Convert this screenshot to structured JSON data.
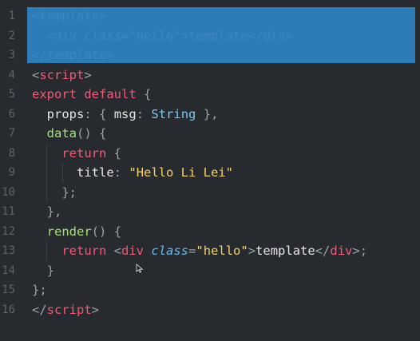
{
  "editor": {
    "line_numbers": [
      "1",
      "2",
      "3",
      "4",
      "5",
      "6",
      "7",
      "8",
      "9",
      "10",
      "11",
      "12",
      "13",
      "14",
      "15",
      "16"
    ],
    "lines": [
      {
        "indent": "",
        "tokens": [
          {
            "c": "t-punc",
            "t": "<"
          },
          {
            "c": "t-tag",
            "t": "template"
          },
          {
            "c": "t-punc",
            "t": ">"
          }
        ]
      },
      {
        "indent": "  ",
        "tokens": [
          {
            "c": "t-punc",
            "t": "<"
          },
          {
            "c": "t-tag",
            "t": "div"
          },
          {
            "c": "t-text",
            "t": " "
          },
          {
            "c": "t-attr",
            "t": "class"
          },
          {
            "c": "t-punc",
            "t": "="
          },
          {
            "c": "t-str",
            "t": "\"hello\""
          },
          {
            "c": "t-punc",
            "t": ">"
          },
          {
            "c": "t-text",
            "t": "template"
          },
          {
            "c": "t-punc",
            "t": "</"
          },
          {
            "c": "t-tag",
            "t": "div"
          },
          {
            "c": "t-punc",
            "t": ">"
          }
        ]
      },
      {
        "indent": "",
        "tokens": [
          {
            "c": "t-punc",
            "t": "</"
          },
          {
            "c": "t-tag",
            "t": "template"
          },
          {
            "c": "t-punc",
            "t": ">"
          }
        ]
      },
      {
        "indent": "",
        "tokens": [
          {
            "c": "t-punc",
            "t": "<"
          },
          {
            "c": "t-tag",
            "t": "script"
          },
          {
            "c": "t-punc",
            "t": ">"
          }
        ]
      },
      {
        "indent": "",
        "tokens": [
          {
            "c": "t-kw",
            "t": "export"
          },
          {
            "c": "t-text",
            "t": " "
          },
          {
            "c": "t-kw",
            "t": "default"
          },
          {
            "c": "t-text",
            "t": " "
          },
          {
            "c": "t-punc",
            "t": "{"
          }
        ]
      },
      {
        "indent": "  ",
        "tokens": [
          {
            "c": "t-text",
            "t": "props"
          },
          {
            "c": "t-punc",
            "t": ":"
          },
          {
            "c": "t-text",
            "t": " "
          },
          {
            "c": "t-punc",
            "t": "{"
          },
          {
            "c": "t-text",
            "t": " msg"
          },
          {
            "c": "t-punc",
            "t": ":"
          },
          {
            "c": "t-text",
            "t": " "
          },
          {
            "c": "t-type",
            "t": "String"
          },
          {
            "c": "t-text",
            "t": " "
          },
          {
            "c": "t-punc",
            "t": "},"
          }
        ]
      },
      {
        "indent": "  ",
        "tokens": [
          {
            "c": "t-fn",
            "t": "data"
          },
          {
            "c": "t-punc",
            "t": "()"
          },
          {
            "c": "t-text",
            "t": " "
          },
          {
            "c": "t-punc",
            "t": "{"
          }
        ]
      },
      {
        "indent": "    ",
        "tokens": [
          {
            "c": "t-kw",
            "t": "return"
          },
          {
            "c": "t-text",
            "t": " "
          },
          {
            "c": "t-punc",
            "t": "{"
          }
        ]
      },
      {
        "indent": "      ",
        "tokens": [
          {
            "c": "t-text",
            "t": "title"
          },
          {
            "c": "t-punc",
            "t": ":"
          },
          {
            "c": "t-text",
            "t": " "
          },
          {
            "c": "t-str",
            "t": "\"Hello Li Lei\""
          }
        ]
      },
      {
        "indent": "    ",
        "tokens": [
          {
            "c": "t-punc",
            "t": "};"
          }
        ]
      },
      {
        "indent": "  ",
        "tokens": [
          {
            "c": "t-punc",
            "t": "},"
          }
        ]
      },
      {
        "indent": "  ",
        "tokens": [
          {
            "c": "t-fn",
            "t": "render"
          },
          {
            "c": "t-punc",
            "t": "()"
          },
          {
            "c": "t-text",
            "t": " "
          },
          {
            "c": "t-punc",
            "t": "{"
          }
        ]
      },
      {
        "indent": "    ",
        "tokens": [
          {
            "c": "t-kw",
            "t": "return"
          },
          {
            "c": "t-text",
            "t": " "
          },
          {
            "c": "t-punc",
            "t": "<"
          },
          {
            "c": "t-tag",
            "t": "div"
          },
          {
            "c": "t-text",
            "t": " "
          },
          {
            "c": "t-attr",
            "t": "class"
          },
          {
            "c": "t-punc",
            "t": "="
          },
          {
            "c": "t-str",
            "t": "\"hello\""
          },
          {
            "c": "t-punc",
            "t": ">"
          },
          {
            "c": "t-text",
            "t": "template"
          },
          {
            "c": "t-punc",
            "t": "</"
          },
          {
            "c": "t-tag",
            "t": "div"
          },
          {
            "c": "t-punc",
            "t": ">;"
          }
        ]
      },
      {
        "indent": "  ",
        "tokens": [
          {
            "c": "t-punc",
            "t": "}"
          }
        ]
      },
      {
        "indent": "",
        "tokens": [
          {
            "c": "t-punc",
            "t": "};"
          }
        ]
      },
      {
        "indent": "",
        "tokens": [
          {
            "c": "t-punc",
            "t": "</"
          },
          {
            "c": "t-tag",
            "t": "script"
          },
          {
            "c": "t-punc",
            "t": ">"
          }
        ]
      }
    ],
    "selected_lines": [
      1,
      2,
      3
    ],
    "selection_color": "#2e7cb6",
    "background_color": "#272b30",
    "cursor_icon": "arrow-cursor-icon"
  }
}
